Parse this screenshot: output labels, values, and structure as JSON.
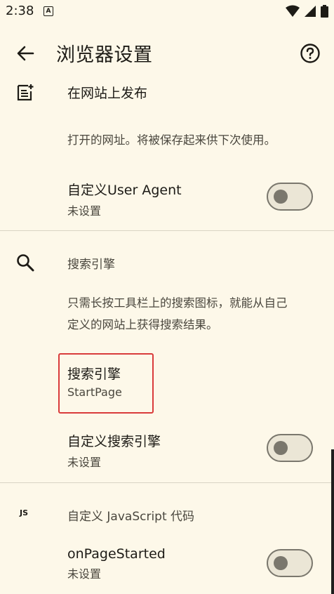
{
  "status_bar": {
    "time": "2:38",
    "notif": "A"
  },
  "app_bar": {
    "title": "浏览器设置"
  },
  "publish_row": {
    "label": "在网站上发布"
  },
  "saved_url_desc": "打开的网址。将被保存起来供下次使用。",
  "user_agent": {
    "label": "自定义User Agent",
    "value": "未设置",
    "enabled": false
  },
  "search_section": {
    "header": "搜索引擎",
    "desc_line1": "只需长按工具栏上的搜索图标，就能从自己",
    "desc_line2": "定义的网站上获得搜索结果。",
    "engine_label": "搜索引擎",
    "engine_value": "StartPage",
    "custom_label": "自定义搜索引擎",
    "custom_value": "未设置",
    "custom_enabled": false
  },
  "js_section": {
    "icon_text": "JS",
    "header": "自定义 JavaScript 代码",
    "page_started_label": "onPageStarted",
    "page_started_value": "未设置",
    "page_started_enabled": false
  },
  "colors": {
    "background": "#fdf8e9",
    "highlight": "#d93b3b"
  }
}
